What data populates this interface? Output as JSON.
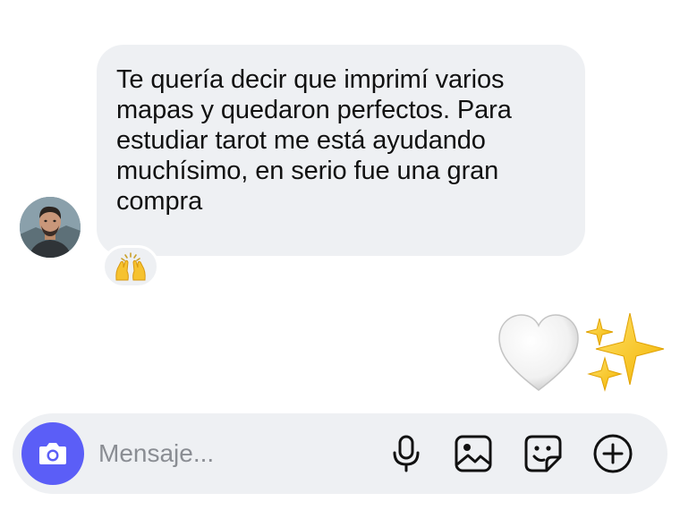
{
  "message": {
    "text": "Te quería decir que imprimí varios mapas y quedaron perfectos. Para estudiar tarot me está ayudando muchísimo, en serio fue una gran compra",
    "lines": [
      "Te quería decir que imprimí varios",
      "mapas y quedaron perfectos. Para",
      "estudiar tarot me está ayudando",
      "muchísimo, en serio fue una gran",
      "compra"
    ],
    "reaction_icon": "raising-hands-emoji"
  },
  "sent": {
    "icons": [
      "white-heart-emoji",
      "sparkles-emoji"
    ]
  },
  "composer": {
    "placeholder": "Mensaje...",
    "camera_icon": "camera-icon",
    "tools": [
      "microphone-icon",
      "gallery-icon",
      "sticker-icon",
      "plus-icon"
    ]
  },
  "colors": {
    "bubble": "#eef0f3",
    "camera_button": "#5b5ef7",
    "placeholder": "#8a8d93",
    "icon": "#111111"
  }
}
